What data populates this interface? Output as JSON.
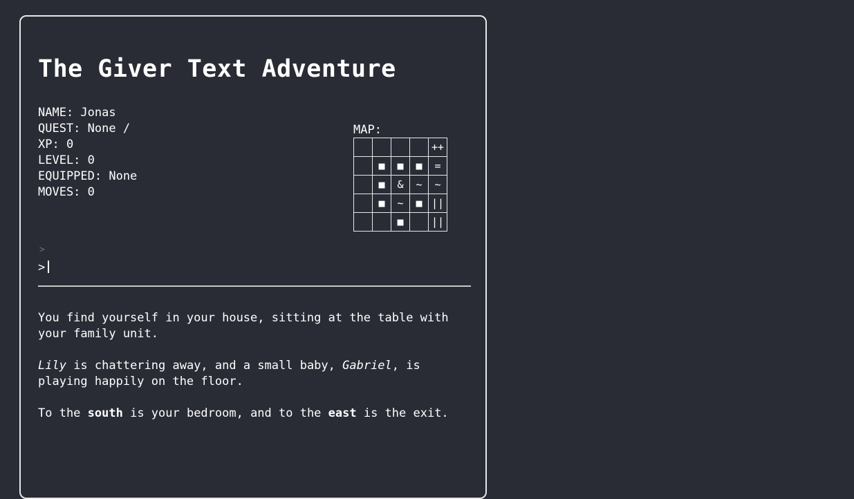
{
  "game": {
    "title": "The Giver Text Adventure"
  },
  "stats": {
    "name": "NAME: Jonas",
    "quest": "QUEST: None /",
    "xp": "XP: 0",
    "level": "LEVEL: 0",
    "equipped": "EQUIPPED: None",
    "moves": "MOVES: 0"
  },
  "map": {
    "label": "MAP:",
    "rows": [
      [
        "",
        "",
        "",
        "",
        "++"
      ],
      [
        "",
        "■",
        "■",
        "■",
        "="
      ],
      [
        "",
        "■",
        "&",
        "~",
        "~"
      ],
      [
        "",
        "■",
        "~",
        "■",
        "||"
      ],
      [
        "",
        "",
        "■",
        "",
        "||"
      ]
    ]
  },
  "prompt": {
    "history": ">",
    "symbol": ">"
  },
  "story": {
    "p1": "You find yourself in your house, sitting at the table with your family unit.",
    "p2_name1": "Lily",
    "p2_mid": " is chattering away, and a small baby, ",
    "p2_name2": "Gabriel",
    "p2_end": ", is playing happily on the floor.",
    "p3_start": "To the ",
    "p3_south": "south",
    "p3_mid": " is your bedroom, and to the ",
    "p3_east": "east",
    "p3_end": " is the exit."
  }
}
